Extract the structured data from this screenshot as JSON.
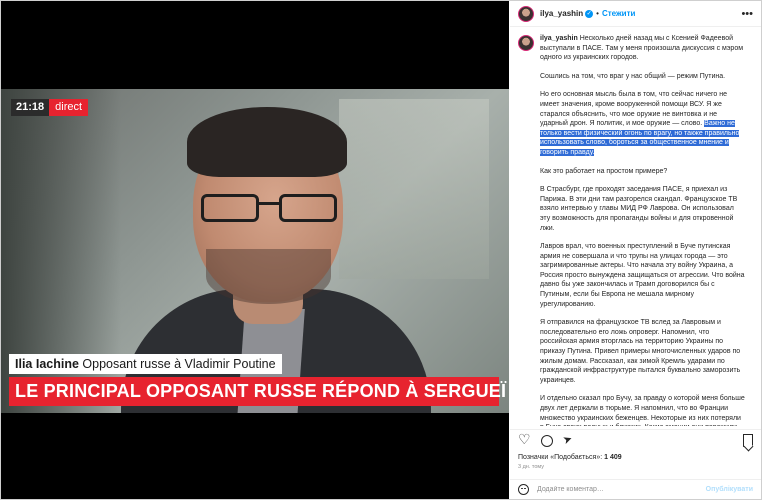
{
  "video": {
    "time": "21:18",
    "live_label": "direct",
    "name": "Ilia Iachine",
    "name_role": "Opposant russe à Vladimir Poutine",
    "headline": "LE PRINCIPAL OPPOSANT RUSSE RÉPOND À SERGUEÏ LAVROV"
  },
  "post": {
    "username": "ilya_yashin",
    "follow_label": "Стежити",
    "verified_mark": "✓",
    "caption": {
      "p1": "Несколько дней назад мы с Ксенией Фадеевой выступали в ПАСЕ. Там у меня произошла дискуссия с мэром одного из украинских городов.",
      "p2": "Сошлись на том, что враг у нас общий — режим Путина.",
      "p3a": "Но его основная мысль была в том, что сейчас ничего не имеет значения, кроме вооруженной помощи ВСУ. Я же старался объяснить, что мое оружие не винтовка и не ударный дрон. Я политик, и мое оружие — слово.",
      "p3b": "Важно не только вести физический огонь по врагу, но также правильно использовать слово, бороться за общественное мнение и говорить правду.",
      "p4": "Как это работает на простом примере?",
      "p5": "В Страсбург, где проходят заседания ПАСЕ, я приехал из Парижа. В эти дни там разгорелся скандал. Французское ТВ взяло интервью у главы МИД РФ Лаврова. Он использовал эту возможность для пропаганды войны и для откровенной лжи.",
      "p6": "Лавров врал, что военных преступлений в Буче путинская армия не совершала и что трупы на улицах города — это загримированные актеры. Что начала эту войну Украина, а Россия просто вынуждена защищаться от агрессии. Что война давно бы уже закончилась и Трамп договорился бы с Путиным, если бы Европа не мешала мирному урегулированию.",
      "p7": "Я отправился на французское ТВ вслед за Лавровым и последовательно его ложь опроверг. Напомнил, что российская армия вторглась на территорию Украины по приказу Путина. Привел примеры многочисленных ударов по жилым домам. Рассказал, как зимой Кремль ударами по гражданской инфраструктуре пытался буквально заморозить украинцев.",
      "p8": "И отдельно сказал про Бучу, за правду о которой меня больше двух лет держали в тюрьме. Я напомнил, что во Франции множество украинских беженцев. Некоторые из них потеряли в Буче своих родных и близких. Какие эмоции они пережили, когда услышали в эфире европейского"
    },
    "likes_prefix": "Позначки «Подобається»:",
    "likes_count": "1 409",
    "time_ago": "3 дн. тому",
    "comment_placeholder": "Додайте коментар…",
    "publish_label": "Опублікувати",
    "more_icon": "•••"
  },
  "colors": {
    "accent_red": "#e7232f",
    "link_blue": "#0095f6",
    "selection_blue": "#2f6bd6"
  }
}
